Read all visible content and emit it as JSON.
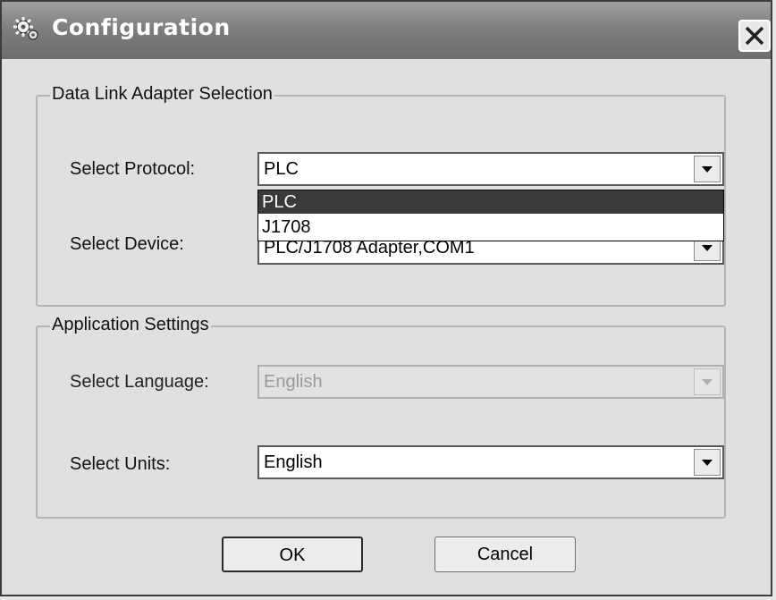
{
  "window": {
    "title": "Configuration",
    "icon": "gear-icon",
    "close_icon": "close-icon"
  },
  "data_link": {
    "group_title": "Data Link Adapter Selection",
    "protocol_label": "Select Protocol:",
    "protocol_value": "PLC",
    "protocol_options": [
      "PLC",
      "J1708"
    ],
    "protocol_highlighted": "PLC",
    "device_label": "Select Device:",
    "device_value": "PLC/J1708 Adapter,COM1"
  },
  "app_settings": {
    "group_title": "Application Settings",
    "language_label": "Select Language:",
    "language_value": "English",
    "language_enabled": false,
    "units_label": "Select Units:",
    "units_value": "English"
  },
  "buttons": {
    "ok_label": "OK",
    "cancel_label": "Cancel"
  },
  "colors": {
    "titlebar": "#7c7c7c",
    "dialog_bg": "#e0e0e0",
    "selection": "#3a3a3a"
  }
}
